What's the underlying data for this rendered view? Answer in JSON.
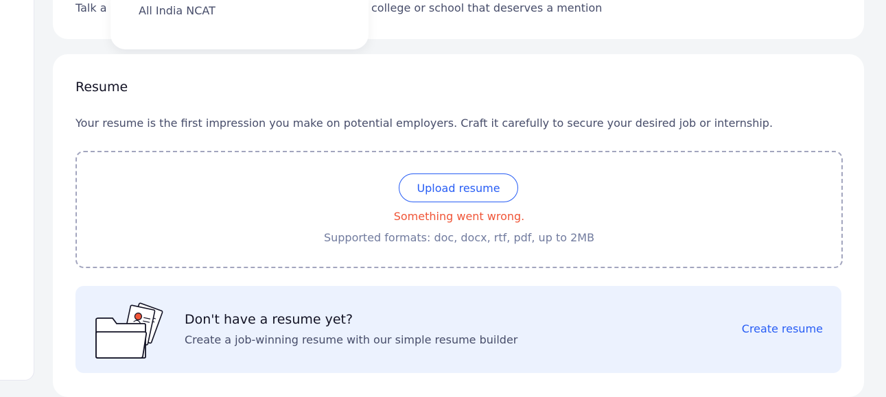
{
  "top_section": {
    "description_start": "Talk a",
    "description_end": "college or school that deserves a mention"
  },
  "suggestions": {
    "items": [
      "All India NCAT"
    ]
  },
  "resume": {
    "title": "Resume",
    "description": "Your resume is the first impression you make on potential employers. Craft it carefully to secure your desired job or internship.",
    "upload_label": "Upload resume",
    "error_message": "Something went wrong.",
    "formats_note": "Supported formats: doc, docx, rtf, pdf, up to 2MB"
  },
  "builder_banner": {
    "title": "Don't have a resume yet?",
    "subtitle": "Create a job-winning resume with our simple resume builder",
    "cta_label": "Create resume",
    "illustration_icon": "folder-with-resume-icon"
  },
  "colors": {
    "accent": "#275df5",
    "error": "#f05537",
    "banner_bg": "#ecf2fe",
    "page_bg": "#f3f5f7"
  }
}
